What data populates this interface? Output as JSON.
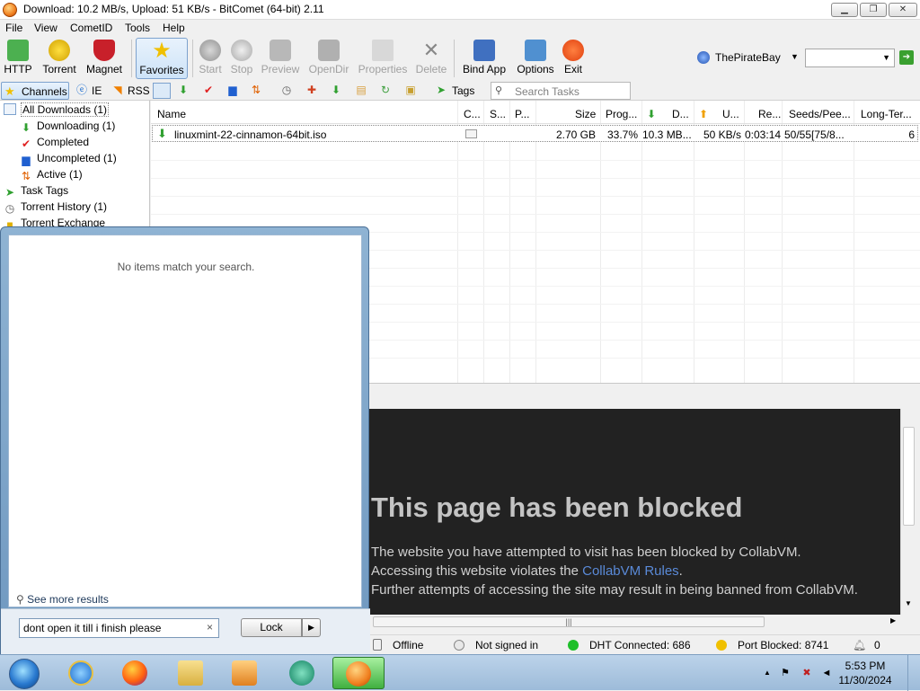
{
  "window": {
    "title": "Download: 10.2 MB/s, Upload: 51 KB/s - BitComet (64-bit) 2.11"
  },
  "menu": [
    "File",
    "View",
    "CometID",
    "Tools",
    "Help"
  ],
  "toolbar": {
    "buttons": [
      {
        "label": "HTTP"
      },
      {
        "label": "Torrent"
      },
      {
        "label": "Magnet"
      },
      {
        "label": "Favorites"
      },
      {
        "label": "Start"
      },
      {
        "label": "Stop"
      },
      {
        "label": "Preview"
      },
      {
        "label": "OpenDir"
      },
      {
        "label": "Properties"
      },
      {
        "label": "Delete"
      },
      {
        "label": "Bind App"
      },
      {
        "label": "Options"
      },
      {
        "label": "Exit"
      }
    ],
    "search_site": "ThePirateBay"
  },
  "toolbar2": {
    "channels": "Channels",
    "ie": "IE",
    "rss": "RSS",
    "tags": "Tags",
    "search_placeholder": "Search Tasks"
  },
  "tree": [
    {
      "label": "All Downloads (1)"
    },
    {
      "label": "Downloading (1)"
    },
    {
      "label": "Completed"
    },
    {
      "label": "Uncompleted (1)"
    },
    {
      "label": "Active (1)"
    },
    {
      "label": "Task Tags"
    },
    {
      "label": "Torrent History (1)"
    },
    {
      "label": "Torrent Exchange"
    }
  ],
  "table": {
    "columns": [
      "Name",
      "C...",
      "S...",
      "P...",
      "Size",
      "Prog...",
      "D...",
      "U...",
      "Re...",
      "Seeds/Pee...",
      "Long-Ter..."
    ],
    "rows": [
      {
        "name": "linuxmint-22-cinnamon-64bit.iso",
        "size": "2.70 GB",
        "progress": "33.7%",
        "down": "10.3 MB...",
        "up": "50 KB/s",
        "remaining": "0:03:14",
        "seeds": "50/55[75/8...",
        "longterm": "6"
      }
    ]
  },
  "web": {
    "heading": "This page has been blocked",
    "line1": "The website you have attempted to visit has been blocked by CollabVM.",
    "line2_pre": "Accessing this website violates the ",
    "line2_link": "CollabVM Rules",
    "line2_post": ".",
    "line3": "Further attempts of accessing the site may result in being banned from CollabVM."
  },
  "status": {
    "offline": "Offline",
    "signin": "Not signed in",
    "dht": "DHT Connected: 686",
    "port": "Port Blocked: 8741",
    "count": "0"
  },
  "startmenu": {
    "empty": "No items match your search.",
    "more": "See more results",
    "search_value": "dont open it till i finish please",
    "clear": "×",
    "lock": "Lock"
  },
  "taskbar": {
    "time": "5:53 PM",
    "date": "11/30/2024"
  },
  "colors": {
    "accent": "#7da2ce",
    "web_bg": "#222222",
    "link": "#5a8ad8",
    "dht_green": "#1fbf2a",
    "port_yellow": "#f0c000"
  }
}
